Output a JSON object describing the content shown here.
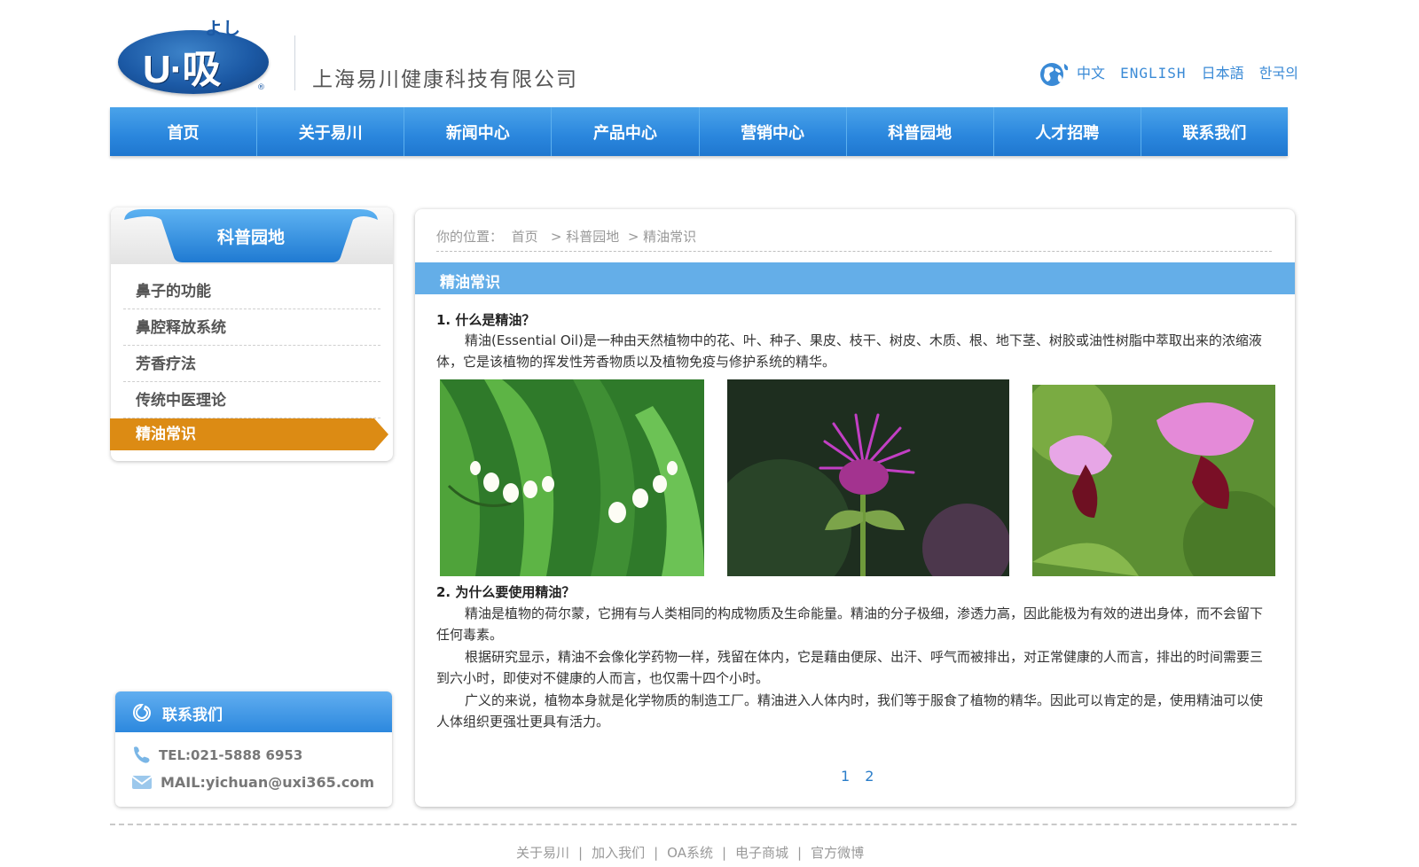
{
  "header": {
    "logo_text": "U·吸",
    "logo_kana": "よし",
    "logo_reg": "®",
    "company_name": "上海易川健康科技有限公司",
    "languages": [
      "中文",
      "ENGLISH",
      "日本語",
      "한국의"
    ]
  },
  "nav": {
    "items": [
      "首页",
      "关于易川",
      "新闻中心",
      "产品中心",
      "营销中心",
      "科普园地",
      "人才招聘",
      "联系我们"
    ]
  },
  "sidebar": {
    "title": "科普园地",
    "items": [
      "鼻子的功能",
      "鼻腔释放系统",
      "芳香疗法",
      "传统中医理论",
      "精油常识"
    ],
    "active_index": 4
  },
  "contact": {
    "title": "联系我们",
    "tel": "TEL:021-5888 6953",
    "mail": "MAIL:yichuan@uxi365.com"
  },
  "breadcrumb": {
    "prefix": "你的位置：",
    "home": "首页",
    "separator": ">",
    "level1": "科普园地",
    "current": "精油常识"
  },
  "article": {
    "section_title": "精油常识",
    "q1_title": "1. 什么是精油？",
    "q1_para": "精油(Essential Oil)是一种由天然植物中的花、叶、种子、果皮、枝干、树皮、木质、根、地下茎、树胶或油性树脂中萃取出来的浓缩液体，它是该植物的挥发性芳香物质以及植物免疫与修护系统的精华。",
    "q2_title": "2. 为什么要使用精油？",
    "q2_paras": [
      "精油是植物的荷尔蒙，它拥有与人类相同的构成物质及生命能量。精油的分子极细，渗透力高，因此能极为有效的进出身体，而不会留下任何毒素。",
      "根据研究显示，精油不会像化学药物一样，残留在体内，它是藉由便尿、出汗、呼气而被排出，对正常健康的人而言，排出的时间需要三到六小时，即使对不健康的人而言，也仅需十四个小时。",
      "广义的来说，植物本身就是化学物质的制造工厂。精油进入人体内时，我们等于服食了植物的精华。因此可以肯定的是，使用精油可以使人体组织更强壮更具有活力。"
    ],
    "pages": [
      "1",
      "2"
    ]
  },
  "footer": {
    "links": [
      "关于易川",
      "加入我们",
      "OA系统",
      "电子商城",
      "官方微博"
    ],
    "separator": "|"
  },
  "colors": {
    "nav_blue": "#2a86dd",
    "section_blue": "#64aee8",
    "active_orange": "#dc8b14",
    "brand_blue": "#1c5aa6"
  },
  "icons": [
    "globe-icon",
    "phone-icon",
    "mail-icon",
    "contact-bubble-icon"
  ]
}
